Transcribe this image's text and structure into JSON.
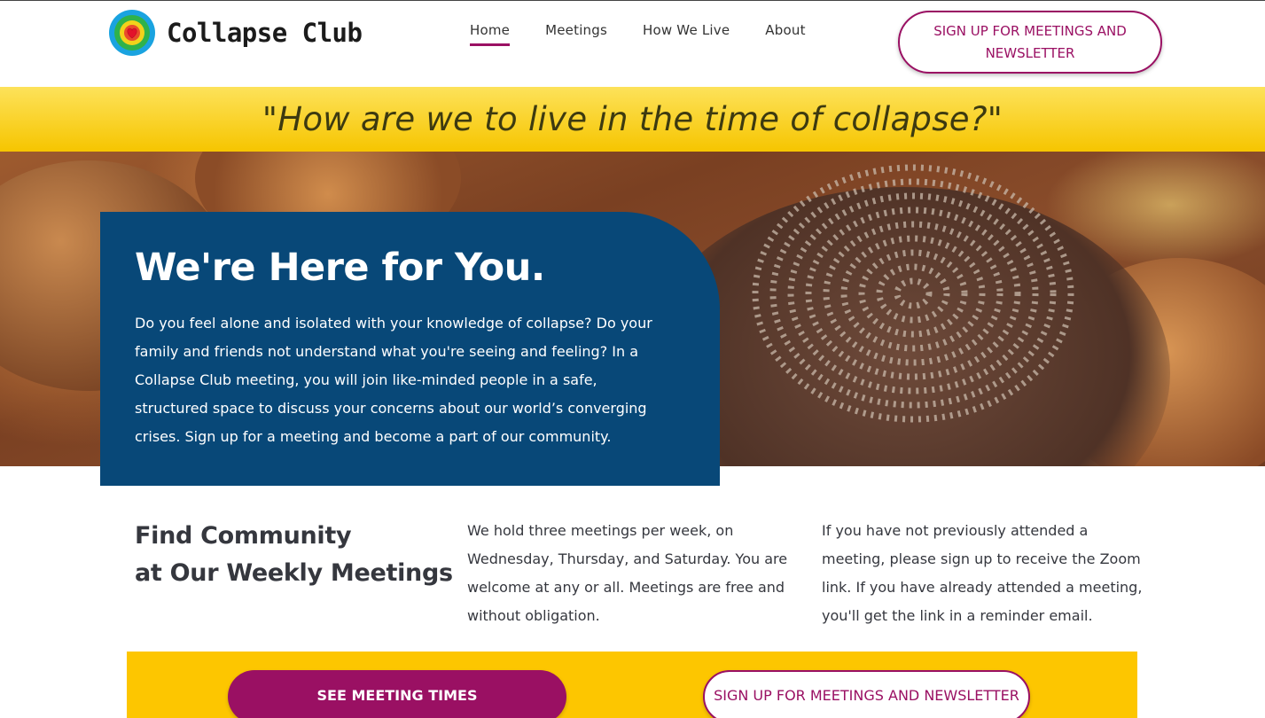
{
  "header": {
    "logo_text": "Collapse Club",
    "logo_icon": "target-heart-icon",
    "nav": [
      {
        "label": "Home",
        "active": true
      },
      {
        "label": "Meetings",
        "active": false
      },
      {
        "label": "How We Live",
        "active": false
      },
      {
        "label": "About",
        "active": false
      }
    ],
    "cta_label": "SIGN UP FOR MEETINGS AND NEWSLETTER"
  },
  "banner": {
    "quote": "\"How are we to live in the time of collapse?\""
  },
  "hero": {
    "title": "We're Here for You.",
    "body": "Do you feel alone and isolated with your knowledge of collapse? Do your family and friends not understand what you're seeing and feeling? In a Collapse Club meeting, you will join like-minded people in a safe, structured space to discuss your concerns about our world’s converging crises. Sign up for a meeting and become a part of our community."
  },
  "community": {
    "title_line1": "Find Community",
    "title_line2": "at Our Weekly Meetings",
    "col2": "We hold three meetings per week, on Wednesday, Thursday, and Saturday. You are welcome at any or all. Meetings are free and without obligation.",
    "col3": "If you have not previously attended a meeting, please sign up to receive the Zoom link. If you have already attended a meeting, you'll get the link in a reminder email."
  },
  "cta_band": {
    "see_times_label": "SEE MEETING TIMES",
    "signup_label": "SIGN UP FOR MEETINGS AND NEWSLETTER"
  },
  "colors": {
    "brand_magenta": "#9a1063",
    "hero_blue": "#084878",
    "banner_yellow": "#f6c500",
    "cta_yellow": "#fdc600"
  }
}
